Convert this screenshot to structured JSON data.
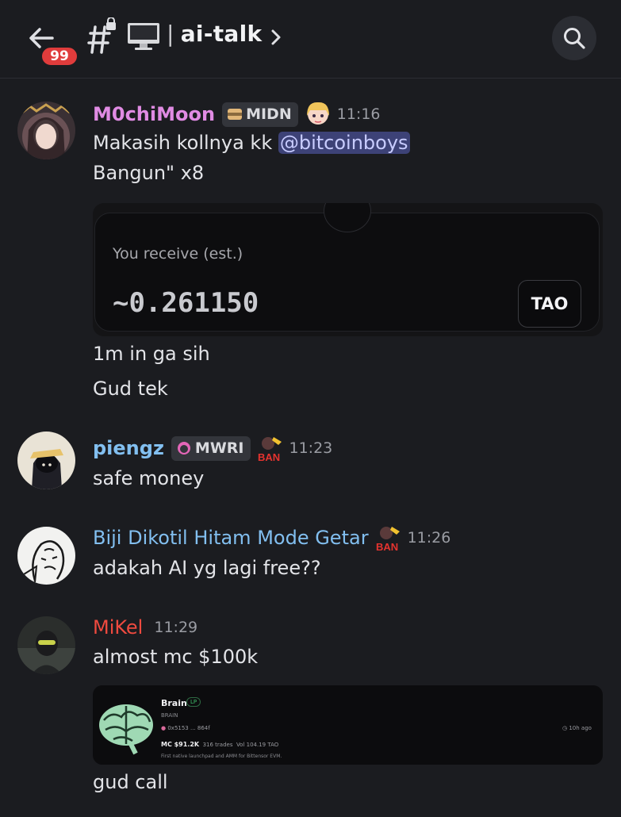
{
  "header": {
    "unread_count": "99",
    "separator": "|",
    "channel_name": "ai-talk"
  },
  "messages": [
    {
      "author": "M0chiMoon",
      "author_color": "#e08be3",
      "tag": "MIDN",
      "time": "11:16",
      "lines": [
        "Makasih kollnya kk ",
        "Bangun\" x8"
      ],
      "mention": "@bitcoinboys",
      "embed": {
        "label": "You receive (est.)",
        "value": "~0.261150",
        "token_button": "TAO"
      },
      "after_lines": [
        "1m in ga sih",
        "Gud tek"
      ]
    },
    {
      "author": "piengz",
      "author_color": "#82bff0",
      "tag": "MWRI",
      "time": "11:23",
      "lines": [
        "safe money"
      ]
    },
    {
      "author": "Biji Dikotil Hitam Mode Getar",
      "author_color": "#82bff0",
      "time": "11:26",
      "lines": [
        "adakah AI yg lagi free??"
      ]
    },
    {
      "author": "MiKel",
      "author_color": "#ef4a3f",
      "time": "11:29",
      "lines": [
        "almost mc $100k"
      ],
      "embed": {
        "name": "Brain",
        "badge": "LP",
        "symbol": "BRAIN",
        "address": "0x5153 ... 864f",
        "age": "10h ago",
        "mc": "MC $91.2K",
        "trades": "316 trades",
        "volume": "Vol 104.19 TAO",
        "description": "First native launchpad and AMM for Bittensor EVM."
      },
      "after_lines": [
        "gud call"
      ]
    }
  ],
  "colors": {
    "background": "#1b1c20",
    "mention_bg": "#3d4277",
    "badge_red": "#e03c3c"
  },
  "icons": [
    "back-arrow-icon",
    "hashtag-lock-icon",
    "monitor-icon",
    "chevron-right-icon",
    "search-icon",
    "role-ban-icon"
  ]
}
